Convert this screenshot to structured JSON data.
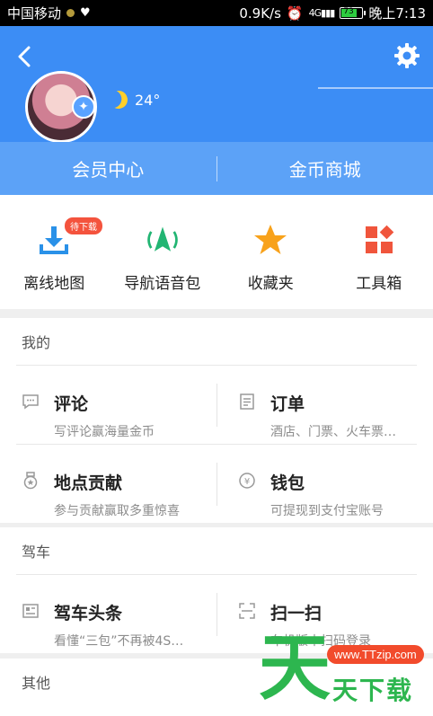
{
  "status_bar": {
    "carrier": "中国移动",
    "speed": "0.9K/s",
    "signal": "4G",
    "battery": "73",
    "time": "晚上7:13"
  },
  "header": {
    "temperature": "24°",
    "colors": {
      "primary": "#3c8df5",
      "member_bar": "#5ca2f7"
    }
  },
  "member_bar": {
    "items": [
      "会员中心",
      "金币商城"
    ]
  },
  "tools": [
    {
      "label": "离线地图",
      "icon": "download-icon",
      "badge": "待下载"
    },
    {
      "label": "导航语音包",
      "icon": "navigation-voice-icon"
    },
    {
      "label": "收藏夹",
      "icon": "star-icon"
    },
    {
      "label": "工具箱",
      "icon": "toolbox-icon"
    }
  ],
  "sections": {
    "mine": {
      "title": "我的",
      "items": [
        {
          "title": "评论",
          "subtitle": "写评论赢海量金币",
          "icon": "comment-icon"
        },
        {
          "title": "订单",
          "subtitle": "酒店、门票、火车票…",
          "icon": "order-icon"
        },
        {
          "title": "地点贡献",
          "subtitle": "参与贡献赢取多重惊喜",
          "icon": "medal-icon"
        },
        {
          "title": "钱包",
          "subtitle": "可提现到支付宝账号",
          "icon": "wallet-icon"
        }
      ]
    },
    "driving": {
      "title": "驾车",
      "items": [
        {
          "title": "驾车头条",
          "subtitle": "看懂“三包”不再被4S…",
          "icon": "news-icon"
        },
        {
          "title": "扫一扫",
          "subtitle": "车机版本扫码登录",
          "icon": "scan-icon"
        }
      ]
    },
    "other": {
      "title": "其他"
    }
  },
  "watermark": {
    "big_char": "天",
    "url": "www.TTzip.com",
    "text": "天下载"
  }
}
